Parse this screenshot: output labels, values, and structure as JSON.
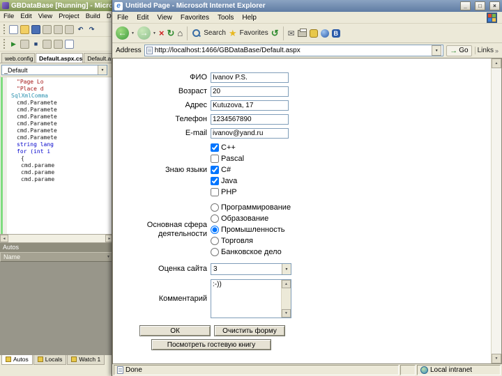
{
  "vs": {
    "title": "GBDataBase [Running] - Microsoft Vi",
    "menus": [
      "File",
      "Edit",
      "View",
      "Project",
      "Build",
      "Deb"
    ],
    "tabs": [
      "web.config",
      "Default.aspx.cs",
      "Default.a"
    ],
    "object_combo": "_Default",
    "code_lines": [
      "\"Page Lo",
      "\"Place d",
      "SqlXmlComma",
      "cmd.Paramete",
      "cmd.Paramete",
      "cmd.Paramete",
      "cmd.Paramete",
      "cmd.Paramete",
      "cmd.Paramete",
      "string lang",
      "for (int i",
      "{",
      "cmd.parame",
      "cmd.parame",
      "cmd.parame"
    ],
    "autos": {
      "caption": "Autos",
      "column": "Name"
    },
    "bottom_tabs": [
      "Autos",
      "Locals",
      "Watch 1"
    ]
  },
  "ie": {
    "title": "Untitled Page - Microsoft Internet Explorer",
    "menus": [
      "File",
      "Edit",
      "View",
      "Favorites",
      "Tools",
      "Help"
    ],
    "toolbar": {
      "search": "Search",
      "favorites": "Favorites"
    },
    "address": {
      "label": "Address",
      "value": "http://localhost:1466/GBDataBase/Default.aspx",
      "go": "Go",
      "links": "Links"
    },
    "status": {
      "left": "Done",
      "zone": "Local intranet"
    }
  },
  "form": {
    "fio": {
      "label": "ФИО",
      "value": "Ivanov P.S."
    },
    "age": {
      "label": "Возраст",
      "value": "20"
    },
    "addr": {
      "label": "Адрес",
      "value": "Kutuzova, 17"
    },
    "phone": {
      "label": "Телефон",
      "value": "1234567890"
    },
    "email": {
      "label": "E-mail",
      "value": "ivanov@yand.ru"
    },
    "languages_label": "Знаю языки",
    "languages": [
      {
        "label": "C++",
        "checked": true
      },
      {
        "label": "Pascal",
        "checked": false
      },
      {
        "label": "C#",
        "checked": true
      },
      {
        "label": "Java",
        "checked": true
      },
      {
        "label": "PHP",
        "checked": false
      }
    ],
    "sphere_label": "Основная сфера деятельности",
    "spheres": [
      {
        "label": "Программирование",
        "checked": false
      },
      {
        "label": "Образование",
        "checked": false
      },
      {
        "label": "Промышленность",
        "checked": true
      },
      {
        "label": "Торговля",
        "checked": false
      },
      {
        "label": "Банковское дело",
        "checked": false
      }
    ],
    "rating": {
      "label": "Оценка сайта",
      "value": "3"
    },
    "comment": {
      "label": "Комментарий",
      "value": ":-))"
    },
    "buttons": {
      "ok": "ОК",
      "clear": "Очистить форму",
      "view": "Посмотреть гостевую книгу"
    }
  },
  "icons": {
    "back": "←",
    "forward": "→",
    "stop": "×",
    "refresh": "↻",
    "home": "⌂",
    "star": "★",
    "history": "↺",
    "mail": "✉",
    "go": "→",
    "chevron": "»",
    "min": "_",
    "max": "□",
    "close": "×",
    "up": "▲",
    "down": "▼",
    "left": "◄",
    "right": "►",
    "play": "▶",
    "stop_sq": "■",
    "undo": "↶",
    "redo": "↷"
  }
}
